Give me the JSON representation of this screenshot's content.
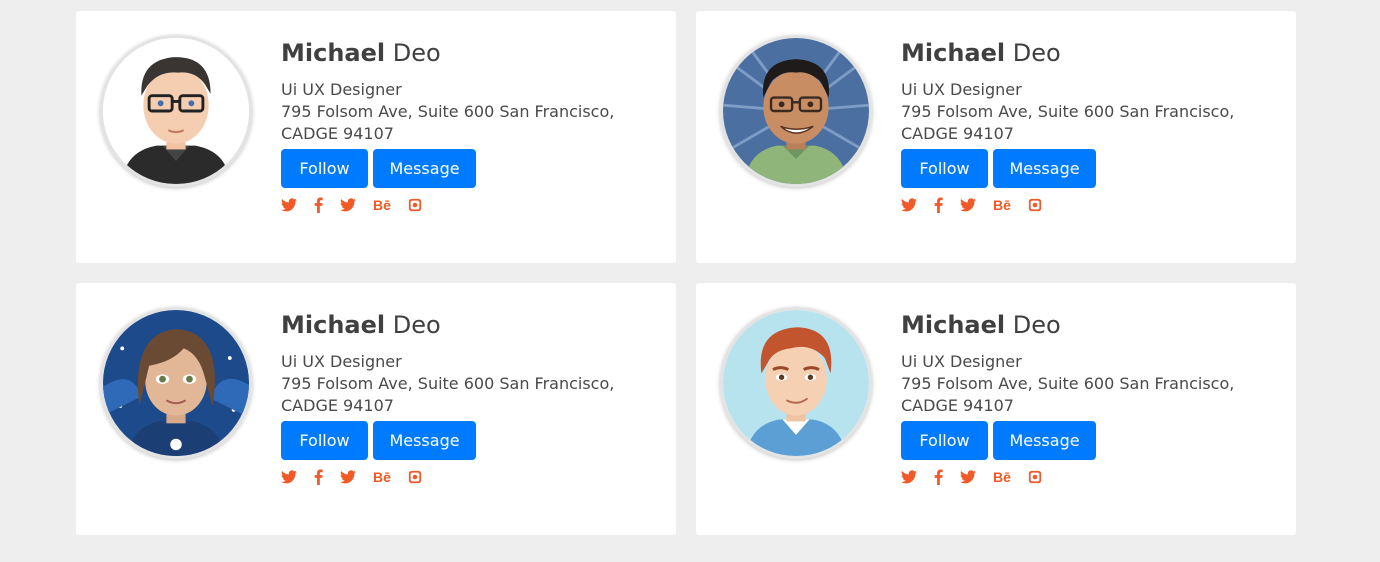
{
  "cards": [
    {
      "first_name": "Michael",
      "last_name": "Deo",
      "role": "Ui UX Designer",
      "address": "795 Folsom Ave, Suite 600 San Francisco, CADGE 94107",
      "follow_label": "Follow",
      "message_label": "Message",
      "behance_label": "Bē"
    },
    {
      "first_name": "Michael",
      "last_name": "Deo",
      "role": "Ui UX Designer",
      "address": "795 Folsom Ave, Suite 600 San Francisco, CADGE 94107",
      "follow_label": "Follow",
      "message_label": "Message",
      "behance_label": "Bē"
    },
    {
      "first_name": "Michael",
      "last_name": "Deo",
      "role": "Ui UX Designer",
      "address": "795 Folsom Ave, Suite 600 San Francisco, CADGE 94107",
      "follow_label": "Follow",
      "message_label": "Message",
      "behance_label": "Bē"
    },
    {
      "first_name": "Michael",
      "last_name": "Deo",
      "role": "Ui UX Designer",
      "address": "795 Folsom Ave, Suite 600 San Francisco, CADGE 94107",
      "follow_label": "Follow",
      "message_label": "Message",
      "behance_label": "Bē"
    }
  ],
  "social_icons": [
    "twitter-icon",
    "facebook-icon",
    "twitter-icon",
    "behance-icon",
    "instagram-icon"
  ],
  "colors": {
    "background": "#eeeeee",
    "card": "#ffffff",
    "button": "#007bff",
    "social": "#f05a28",
    "name": "#404040"
  }
}
